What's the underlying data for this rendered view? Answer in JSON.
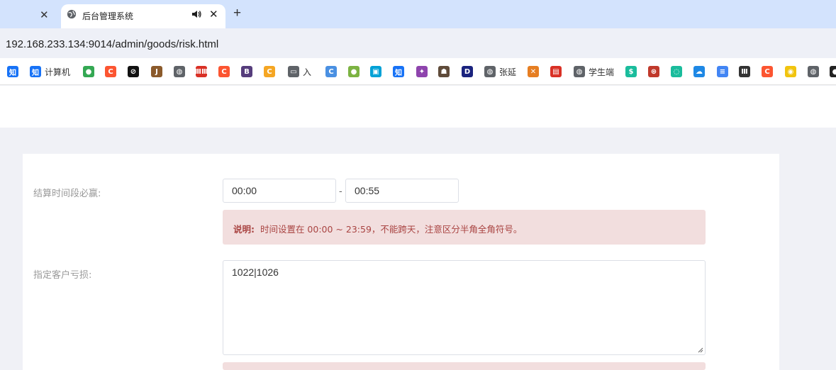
{
  "browser": {
    "tabs": [
      {
        "title": "",
        "active": false
      },
      {
        "title": "后台管理系统",
        "active": true
      }
    ],
    "close_glyph": "✕",
    "new_tab_glyph": "+",
    "url": "192.168.233.134:9014/admin/goods/risk.html"
  },
  "bookmarks": [
    {
      "icon": "zhihu-icon",
      "glyph": "知",
      "color": "#1772f6",
      "label": ""
    },
    {
      "icon": "zhihu-icon",
      "glyph": "知",
      "color": "#1772f6",
      "label": "计算机"
    },
    {
      "icon": "chrome-like-icon",
      "glyph": "●",
      "color": "#34a853",
      "label": ""
    },
    {
      "icon": "csdn-icon",
      "glyph": "C",
      "color": "#fc5531",
      "label": ""
    },
    {
      "icon": "circle-slash-icon",
      "glyph": "⊘",
      "color": "#111111",
      "label": ""
    },
    {
      "icon": "j-icon",
      "glyph": "J",
      "color": "#8b5a2b",
      "label": ""
    },
    {
      "icon": "globe-icon",
      "glyph": "◍",
      "color": "#5f6368",
      "label": ""
    },
    {
      "icon": "red-text-icon",
      "glyph": "ⅢⅢ",
      "color": "#d93025",
      "label": ""
    },
    {
      "icon": "csdn-icon",
      "glyph": "C",
      "color": "#fc5531",
      "label": ""
    },
    {
      "icon": "bootstrap-icon",
      "glyph": "B",
      "color": "#563d7c",
      "label": ""
    },
    {
      "icon": "c-orange-icon",
      "glyph": "C",
      "color": "#f5a623",
      "label": ""
    },
    {
      "icon": "folder-icon",
      "glyph": "▭",
      "color": "#5f6368",
      "label": "入"
    },
    {
      "icon": "c-blue-icon",
      "glyph": "C",
      "color": "#4a90e2",
      "label": ""
    },
    {
      "icon": "green-circle-icon",
      "glyph": "●",
      "color": "#7cb342",
      "label": ""
    },
    {
      "icon": "bilibili-icon",
      "glyph": "▣",
      "color": "#00a1d6",
      "label": ""
    },
    {
      "icon": "zhihu-icon",
      "glyph": "知",
      "color": "#1772f6",
      "label": ""
    },
    {
      "icon": "purple-star-icon",
      "glyph": "✦",
      "color": "#8e44ad",
      "label": ""
    },
    {
      "icon": "people-icon",
      "glyph": "☗",
      "color": "#5f4b3a",
      "label": ""
    },
    {
      "icon": "d-icon",
      "glyph": "D",
      "color": "#1a237e",
      "label": ""
    },
    {
      "icon": "globe-icon",
      "glyph": "◍",
      "color": "#5f6368",
      "label": "张延"
    },
    {
      "icon": "cross-color-icon",
      "glyph": "✕",
      "color": "#e67e22",
      "label": ""
    },
    {
      "icon": "red-book-icon",
      "glyph": "▤",
      "color": "#d93025",
      "label": ""
    },
    {
      "icon": "globe-icon",
      "glyph": "◍",
      "color": "#5f6368",
      "label": "学生端"
    },
    {
      "icon": "dollar-icon",
      "glyph": "$",
      "color": "#1abc9c",
      "label": ""
    },
    {
      "icon": "red-swirl-icon",
      "glyph": "⊛",
      "color": "#c0392b",
      "label": ""
    },
    {
      "icon": "loading-circle-icon",
      "glyph": "◌",
      "color": "#1abc9c",
      "label": ""
    },
    {
      "icon": "cloud-icon",
      "glyph": "☁",
      "color": "#1e88e5",
      "label": ""
    },
    {
      "icon": "doc-icon",
      "glyph": "≡",
      "color": "#4285f4",
      "label": ""
    },
    {
      "icon": "library-icon",
      "glyph": "Ⅲ",
      "color": "#333333",
      "label": ""
    },
    {
      "icon": "csdn-icon",
      "glyph": "C",
      "color": "#fc5531",
      "label": ""
    },
    {
      "icon": "search-globe-icon",
      "glyph": "◉",
      "color": "#f1c40f",
      "label": ""
    },
    {
      "icon": "globe-icon",
      "glyph": "◍",
      "color": "#5f6368",
      "label": ""
    },
    {
      "icon": "dark-circle-icon",
      "glyph": "●",
      "color": "#222222",
      "label": ""
    }
  ],
  "form": {
    "settle_label": "结算时间段必赢:",
    "time_start": "00:00",
    "time_separator": "-",
    "time_end": "00:55",
    "note_title": "说明:",
    "note_text": "时间设置在 00:00 ~ 23:59，不能跨天，注意区分半角全角符号。",
    "loss_label": "指定客户亏损:",
    "loss_value": "1022|1026"
  }
}
